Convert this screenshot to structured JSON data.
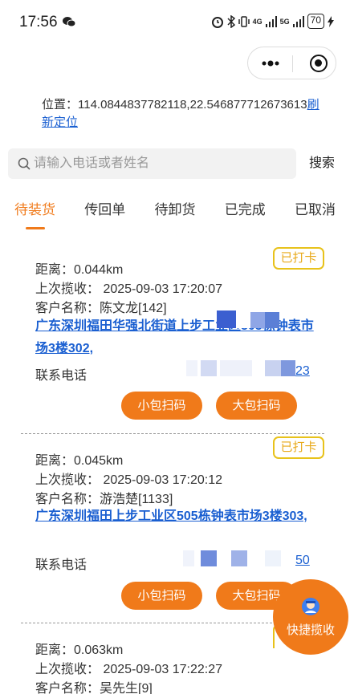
{
  "status_bar": {
    "time": "17:56",
    "network_a": "4G",
    "network_b": "5G",
    "battery": "70"
  },
  "location": {
    "label": "位置：",
    "coords": "114.0844837782118,22.546877712673613",
    "refresh_label": "刷新定位"
  },
  "search": {
    "placeholder": "请输入电话或者姓名",
    "button_label": "搜索"
  },
  "tabs": [
    {
      "label": "待装货"
    },
    {
      "label": "传回单"
    },
    {
      "label": "待卸货"
    },
    {
      "label": "已完成"
    },
    {
      "label": "已取消"
    }
  ],
  "orders": [
    {
      "distance": "距离：0.044km",
      "last_pickup": "上次揽收：  2025-09-03 17:20:07",
      "customer": "客户名称：陈文龙[142]",
      "address": "广东深圳福田华强北街道上步工业区505栋钟表市场3楼302,",
      "phone_label": "联系电话",
      "phone_tail": "23",
      "badge": "已打卡",
      "small_btn": "小包扫码",
      "big_btn": "大包扫码"
    },
    {
      "distance": "距离：0.045km",
      "last_pickup": "上次揽收：  2025-09-03 17:20:12",
      "customer": "客户名称：游浩楚[1133]",
      "address": "广东深圳福田上步工业区505栋钟表市场3楼303,",
      "phone_label": "联系电话",
      "phone_tail": "50",
      "badge": "已打卡",
      "small_btn": "小包扫码",
      "big_btn": "大包扫码"
    },
    {
      "distance": "距离：0.063km",
      "last_pickup": "上次揽收：  2025-09-03 17:22:27",
      "customer": "客户名称：吴先生[9]"
    }
  ],
  "fab": {
    "label": "快捷揽收"
  },
  "colors": {
    "accent": "#f07a1a",
    "link": "#1a5fd1",
    "badge_border": "#e8c21a",
    "mask": "#5b7fd6"
  }
}
